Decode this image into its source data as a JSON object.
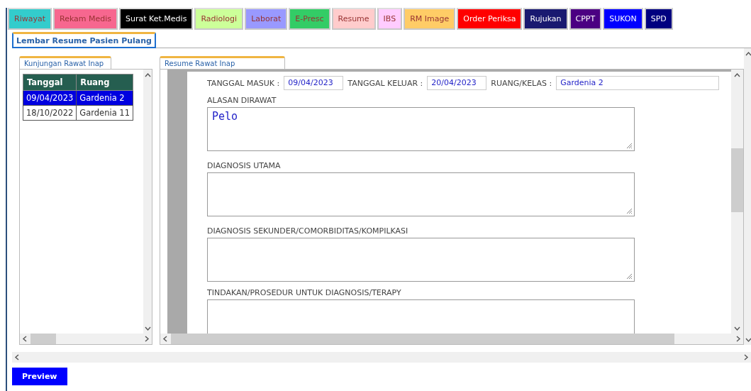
{
  "tabs": [
    {
      "label": "Riwayat",
      "color": "#33cccc"
    },
    {
      "label": "Rekam Medis",
      "color": "#f7678f"
    },
    {
      "label": "Surat Ket.Medis",
      "color": "#000000"
    },
    {
      "label": "Radiologi",
      "color": "#ccff99"
    },
    {
      "label": "Laborat",
      "color": "#9999ff"
    },
    {
      "label": "E-Presc",
      "color": "#33cc66"
    },
    {
      "label": "Resume",
      "color": "#ffcccc"
    },
    {
      "label": "IBS",
      "color": "#ffccff"
    },
    {
      "label": "RM Image",
      "color": "#ffcc66"
    },
    {
      "label": "Order Periksa",
      "color": "#ff0000"
    },
    {
      "label": "Rujukan",
      "color": "#191970"
    },
    {
      "label": "CPPT",
      "color": "#4b0082"
    },
    {
      "label": "SUKON",
      "color": "#0000ff"
    },
    {
      "label": "SPD",
      "color": "#000080"
    }
  ],
  "page_tab": {
    "label": "Lembar Resume Pasien Pulang",
    "selected": true
  },
  "visits": {
    "tab": "Kunjungan Rawat Inap",
    "columns": [
      "Tanggal",
      "Ruang"
    ],
    "rows": [
      {
        "cells": [
          "09/04/2023",
          "Gardenia 2"
        ],
        "selected": true
      },
      {
        "cells": [
          "18/10/2022",
          "Gardenia 11"
        ],
        "selected": false
      }
    ]
  },
  "resume": {
    "tab": "Resume Rawat Inap",
    "header_fields": [
      {
        "label": "TANGGAL MASUK :",
        "value": "09/04/2023"
      },
      {
        "label": "TANGGAL KELUAR :",
        "value": "20/04/2023"
      },
      {
        "label": "RUANG/KELAS :",
        "value": "Gardenia 2"
      }
    ],
    "sections": [
      {
        "label": "ALASAN DIRAWAT",
        "value": "Pelo"
      },
      {
        "label": "DIAGNOSIS UTAMA"
      },
      {
        "label": "DIAGNOSIS SEKUNDER/COMORBIDITAS/KOMPILKASI"
      },
      {
        "label": "TINDAKAN/PROSEDUR UNTUK DIAGNOSIS/TERAPY"
      }
    ]
  },
  "buttons": [
    "Preview"
  ]
}
